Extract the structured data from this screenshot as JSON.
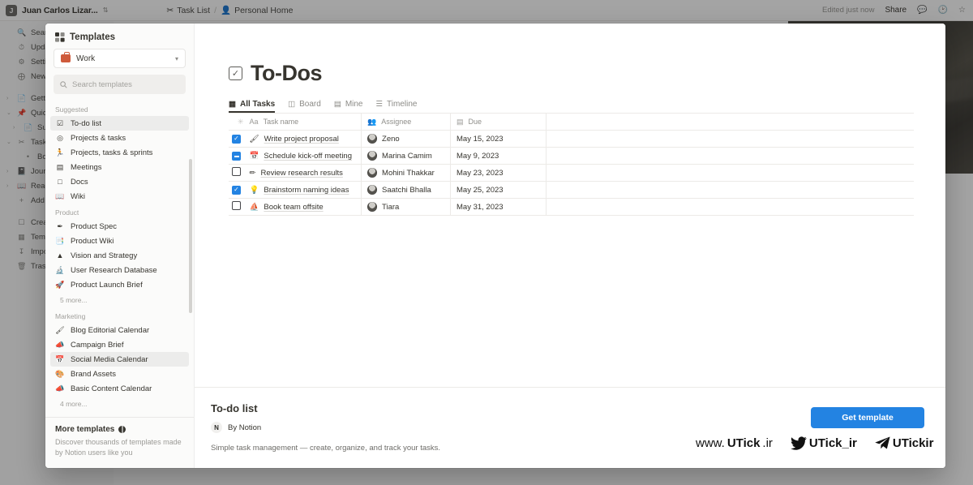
{
  "topbar": {
    "workspace_initial": "J",
    "workspace_name": "Juan Carlos Lizar...",
    "breadcrumbs": [
      {
        "icon": "scissors-icon",
        "label": "Task List"
      },
      {
        "icon": "person-icon",
        "label": "Personal Home"
      }
    ],
    "breadcrumb_separator": "/",
    "edited_status": "Edited just now",
    "share_label": "Share",
    "icons": [
      "comment-icon",
      "clock-icon",
      "star-icon"
    ]
  },
  "leftnav": {
    "items": [
      {
        "icon": "search-icon",
        "label": "Search",
        "indent": 0,
        "arrow": ""
      },
      {
        "icon": "clock-icon",
        "label": "Updates",
        "indent": 0,
        "arrow": ""
      },
      {
        "icon": "gear-icon",
        "label": "Settings",
        "indent": 0,
        "arrow": ""
      },
      {
        "icon": "plus-circle-icon",
        "label": "New page",
        "indent": 0,
        "arrow": ""
      },
      {
        "icon": "",
        "label": "",
        "indent": 0,
        "arrow": "",
        "gap": true
      },
      {
        "icon": "doc-icon",
        "label": "Getting Started",
        "indent": 0,
        "arrow": "›"
      },
      {
        "icon": "pin-icon",
        "label": "Quick Note",
        "indent": 0,
        "arrow": "⌄"
      },
      {
        "icon": "doc-icon",
        "label": "Sub page",
        "indent": 1,
        "arrow": "›"
      },
      {
        "icon": "scissors-icon",
        "label": "Task List",
        "indent": 0,
        "arrow": "⌄"
      },
      {
        "icon": "bullet",
        "label": "Board View",
        "indent": 1,
        "arrow": ""
      },
      {
        "icon": "journal-icon",
        "label": "Journal",
        "indent": 0,
        "arrow": "›"
      },
      {
        "icon": "book-icon",
        "label": "Reading List",
        "indent": 0,
        "arrow": "›"
      },
      {
        "icon": "plus-icon",
        "label": "Add a page",
        "indent": 0,
        "arrow": ""
      },
      {
        "icon": "",
        "label": "",
        "indent": 0,
        "arrow": "",
        "gap": true
      },
      {
        "icon": "create-icon",
        "label": "Create a teamspace",
        "indent": 0,
        "arrow": ""
      },
      {
        "icon": "templates-icon",
        "label": "Templates",
        "indent": 0,
        "arrow": ""
      },
      {
        "icon": "import-icon",
        "label": "Import",
        "indent": 0,
        "arrow": ""
      },
      {
        "icon": "trash-icon",
        "label": "Trash",
        "indent": 0,
        "arrow": ""
      }
    ]
  },
  "templates_panel": {
    "title": "Templates",
    "workspace_select": {
      "icon": "briefcase-icon",
      "value": "Work",
      "chevron": "⌄"
    },
    "search": {
      "placeholder": "Search templates",
      "icon": "search-icon"
    },
    "sections": [
      {
        "label": "Suggested",
        "items": [
          {
            "icon": "☑",
            "label": "To-do list",
            "active": true
          },
          {
            "icon": "◎",
            "label": "Projects & tasks",
            "active": false
          },
          {
            "icon": "🏃",
            "label": "Projects, tasks & sprints",
            "active": false
          },
          {
            "icon": "▤",
            "label": "Meetings",
            "active": false
          },
          {
            "icon": "□",
            "label": "Docs",
            "active": false
          },
          {
            "icon": "📖",
            "label": "Wiki",
            "active": false
          }
        ],
        "more": ""
      },
      {
        "label": "Product",
        "items": [
          {
            "icon": "✒",
            "label": "Product Spec",
            "active": false
          },
          {
            "icon": "📑",
            "label": "Product Wiki",
            "active": false
          },
          {
            "icon": "▲",
            "label": "Vision and Strategy",
            "active": false
          },
          {
            "icon": "🔬",
            "label": "User Research Database",
            "active": false
          },
          {
            "icon": "🚀",
            "label": "Product Launch Brief",
            "active": false
          }
        ],
        "more": "5 more..."
      },
      {
        "label": "Marketing",
        "items": [
          {
            "icon": "🖌",
            "label": "Blog Editorial Calendar",
            "active": false
          },
          {
            "icon": "📣",
            "label": "Campaign Brief",
            "active": false
          },
          {
            "icon": "📅",
            "label": "Social Media Calendar",
            "active": true
          },
          {
            "icon": "🎨",
            "label": "Brand Assets",
            "active": false
          },
          {
            "icon": "📣",
            "label": "Basic Content Calendar",
            "active": false
          }
        ],
        "more": "4 more..."
      }
    ],
    "footer": {
      "title": "More templates",
      "description": "Discover thousands of templates made by Notion users like you"
    }
  },
  "preview": {
    "page_icon": "checkbox-icon",
    "page_title": "To-Dos",
    "tabs": [
      {
        "icon": "table-icon",
        "label": "All Tasks",
        "active": true
      },
      {
        "icon": "board-icon",
        "label": "Board",
        "active": false
      },
      {
        "icon": "grid-icon",
        "label": "Mine",
        "active": false
      },
      {
        "icon": "timeline-icon",
        "label": "Timeline",
        "active": false
      }
    ],
    "table": {
      "columns": [
        {
          "icon": "spinner-icon",
          "label": ""
        },
        {
          "icon": "Aa",
          "label": "Task name"
        },
        {
          "icon": "people-icon",
          "label": "Assignee"
        },
        {
          "icon": "calendar-icon",
          "label": "Due"
        },
        {
          "icon": "",
          "label": ""
        }
      ],
      "rows": [
        {
          "checked": "checked",
          "emoji": "🖌",
          "task": "Write project proposal",
          "assignee": "Zeno",
          "due": "May 15, 2023"
        },
        {
          "checked": "indeterminate",
          "emoji": "📅",
          "task": "Schedule kick-off meeting",
          "assignee": "Marina Camim",
          "due": "May 9, 2023"
        },
        {
          "checked": "unchecked",
          "emoji": "✏",
          "task": "Review research results",
          "assignee": "Mohini Thakkar",
          "due": "May 23, 2023"
        },
        {
          "checked": "checked",
          "emoji": "💡",
          "task": "Brainstorm naming ideas",
          "assignee": "Saatchi Bhalla",
          "due": "May 25, 2023"
        },
        {
          "checked": "unchecked",
          "emoji": "⛵",
          "task": "Book team offsite",
          "assignee": "Tiara",
          "due": "May 31, 2023"
        }
      ]
    },
    "footer": {
      "title": "To-do list",
      "author_mark": "N",
      "author": "By Notion",
      "description": "Simple task management — create, organize, and track your tasks.",
      "cta_label": "Get template"
    }
  },
  "watermark": {
    "site_prefix": "www.",
    "site_main": "UTick",
    "site_suffix": ".ir",
    "twitter_handle": "UTick_ir",
    "telegram_handle": "UTickir"
  },
  "colors": {
    "accent_blue": "#2383e2",
    "text_primary": "#37352f",
    "text_muted": "#9b9a96",
    "panel_bg": "#fbfbfa",
    "brief_orange": "#cf5b3c"
  }
}
